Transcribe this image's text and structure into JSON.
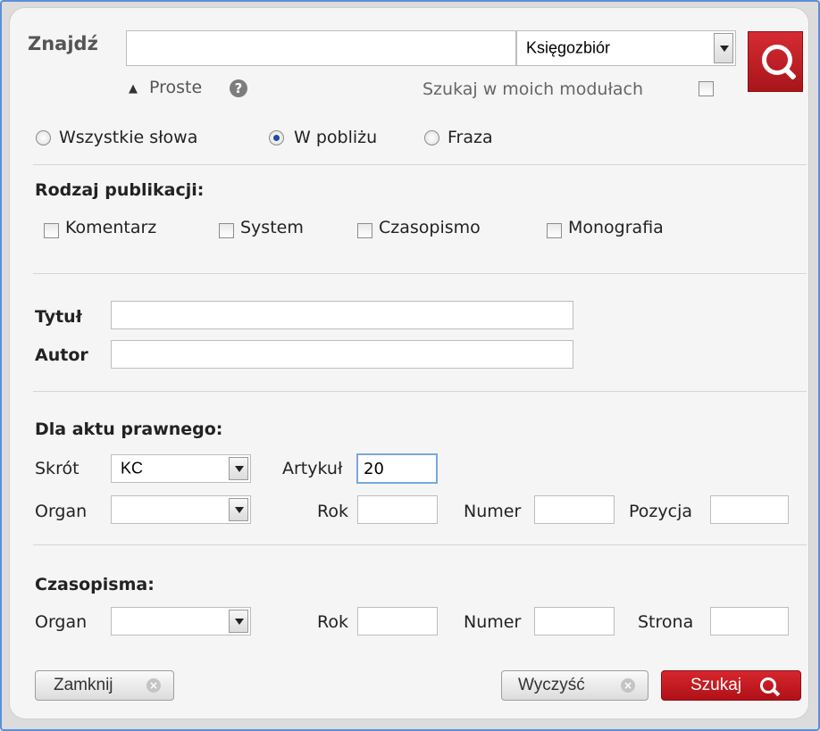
{
  "search": {
    "label": "Znajdź",
    "query_value": "",
    "scope_selected": "Księgozbiór",
    "simple_toggle": "Proste",
    "help_symbol": "?",
    "my_modules_label": "Szukaj w moich modułach"
  },
  "match_modes": [
    {
      "label": "Wszystkie słowa",
      "checked": false
    },
    {
      "label": "W pobliżu",
      "checked": true
    },
    {
      "label": "Fraza",
      "checked": false
    }
  ],
  "publication_type": {
    "heading": "Rodzaj publikacji:",
    "options": [
      "Komentarz",
      "System",
      "Czasopismo",
      "Monografia"
    ]
  },
  "fields": {
    "title_label": "Tytuł",
    "title_value": "",
    "author_label": "Autor",
    "author_value": ""
  },
  "legal_act": {
    "heading": "Dla aktu prawnego:",
    "short_label": "Skrót",
    "short_value": "KC",
    "article_label": "Artykuł",
    "article_value": "20",
    "organ_label": "Organ",
    "organ_value": "",
    "year_label": "Rok",
    "year_value": "",
    "number_label": "Numer",
    "number_value": "",
    "position_label": "Pozycja",
    "position_value": ""
  },
  "journals": {
    "heading": "Czasopisma:",
    "organ_label": "Organ",
    "organ_value": "",
    "year_label": "Rok",
    "year_value": "",
    "number_label": "Numer",
    "number_value": "",
    "page_label": "Strona",
    "page_value": ""
  },
  "buttons": {
    "close": "Zamknij",
    "clear": "Wyczyść",
    "search": "Szukaj",
    "x_symbol": "×"
  },
  "colors": {
    "accent_red": "#c4161c",
    "frame_blue": "#5b8fd8",
    "panel_bg": "#f5f5f5"
  }
}
